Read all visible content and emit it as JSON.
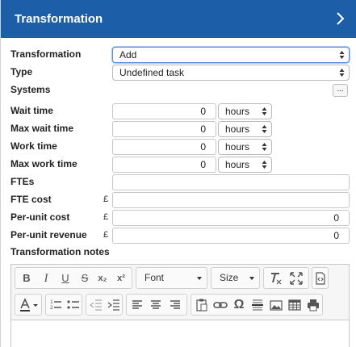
{
  "header": {
    "title": "Transformation"
  },
  "fields": {
    "transformation": {
      "label": "Transformation",
      "value": "Add"
    },
    "type": {
      "label": "Type",
      "value": "Undefined task"
    },
    "systems": {
      "label": "Systems",
      "button": "..."
    },
    "wait_time": {
      "label": "Wait time",
      "value": "0",
      "unit": "hours"
    },
    "max_wait_time": {
      "label": "Max wait time",
      "value": "0",
      "unit": "hours"
    },
    "work_time": {
      "label": "Work time",
      "value": "0",
      "unit": "hours"
    },
    "max_work_time": {
      "label": "Max work time",
      "value": "0",
      "unit": "hours"
    },
    "ftes": {
      "label": "FTEs",
      "value": ""
    },
    "fte_cost": {
      "label": "FTE cost",
      "currency": "£",
      "value": ""
    },
    "per_unit_cost": {
      "label": "Per-unit cost",
      "currency": "£",
      "value": "0"
    },
    "per_unit_revenue": {
      "label": "Per-unit revenue",
      "currency": "£",
      "value": "0"
    },
    "notes": {
      "label": "Transformation notes"
    }
  },
  "editor": {
    "font_label": "Font",
    "size_label": "Size",
    "buttons": {
      "bold": "B",
      "italic": "I",
      "underline": "U",
      "strike": "S",
      "subscript": "x₂",
      "superscript": "x²",
      "omega": "Ω"
    }
  }
}
